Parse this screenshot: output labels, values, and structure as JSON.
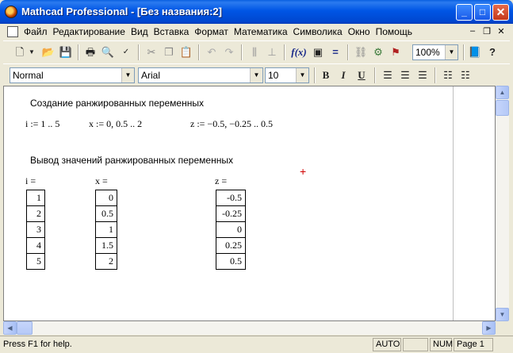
{
  "window": {
    "title": "Mathcad Professional - [Без названия:2]"
  },
  "menu": {
    "items": [
      "Файл",
      "Редактирование",
      "Вид",
      "Вставка",
      "Формат",
      "Математика",
      "Символика",
      "Окно",
      "Помощь"
    ],
    "mdi_min": "–",
    "mdi_restore": "❐",
    "mdi_close": "✕"
  },
  "toolbar": {
    "zoom_value": "100%",
    "function_label": "f(x)",
    "equals_label": "="
  },
  "format_bar": {
    "style_value": "Normal",
    "font_value": "Arial",
    "size_value": "10",
    "bold_label": "B",
    "italic_label": "I",
    "underline_label": "U"
  },
  "worksheet": {
    "heading_define": "Создание ранжированных переменных",
    "def_i": "i := 1 .. 5",
    "def_x": "x := 0, 0.5 .. 2",
    "def_z": "z := −0.5, −0.25 .. 0.5",
    "heading_output": "Вывод значений ранжированных переменных",
    "label_i": "i =",
    "label_x": "x =",
    "label_z": "z =",
    "values_i": [
      "1",
      "2",
      "3",
      "4",
      "5"
    ],
    "values_x": [
      "0",
      "0.5",
      "1",
      "1.5",
      "2"
    ],
    "values_z": [
      "-0.5",
      "-0.25",
      "0",
      "0.25",
      "0.5"
    ],
    "cursor_symbol": "+"
  },
  "status": {
    "help_text": "Press F1 for help.",
    "mode": "AUTO",
    "num": "NUM",
    "page": "Page 1"
  }
}
